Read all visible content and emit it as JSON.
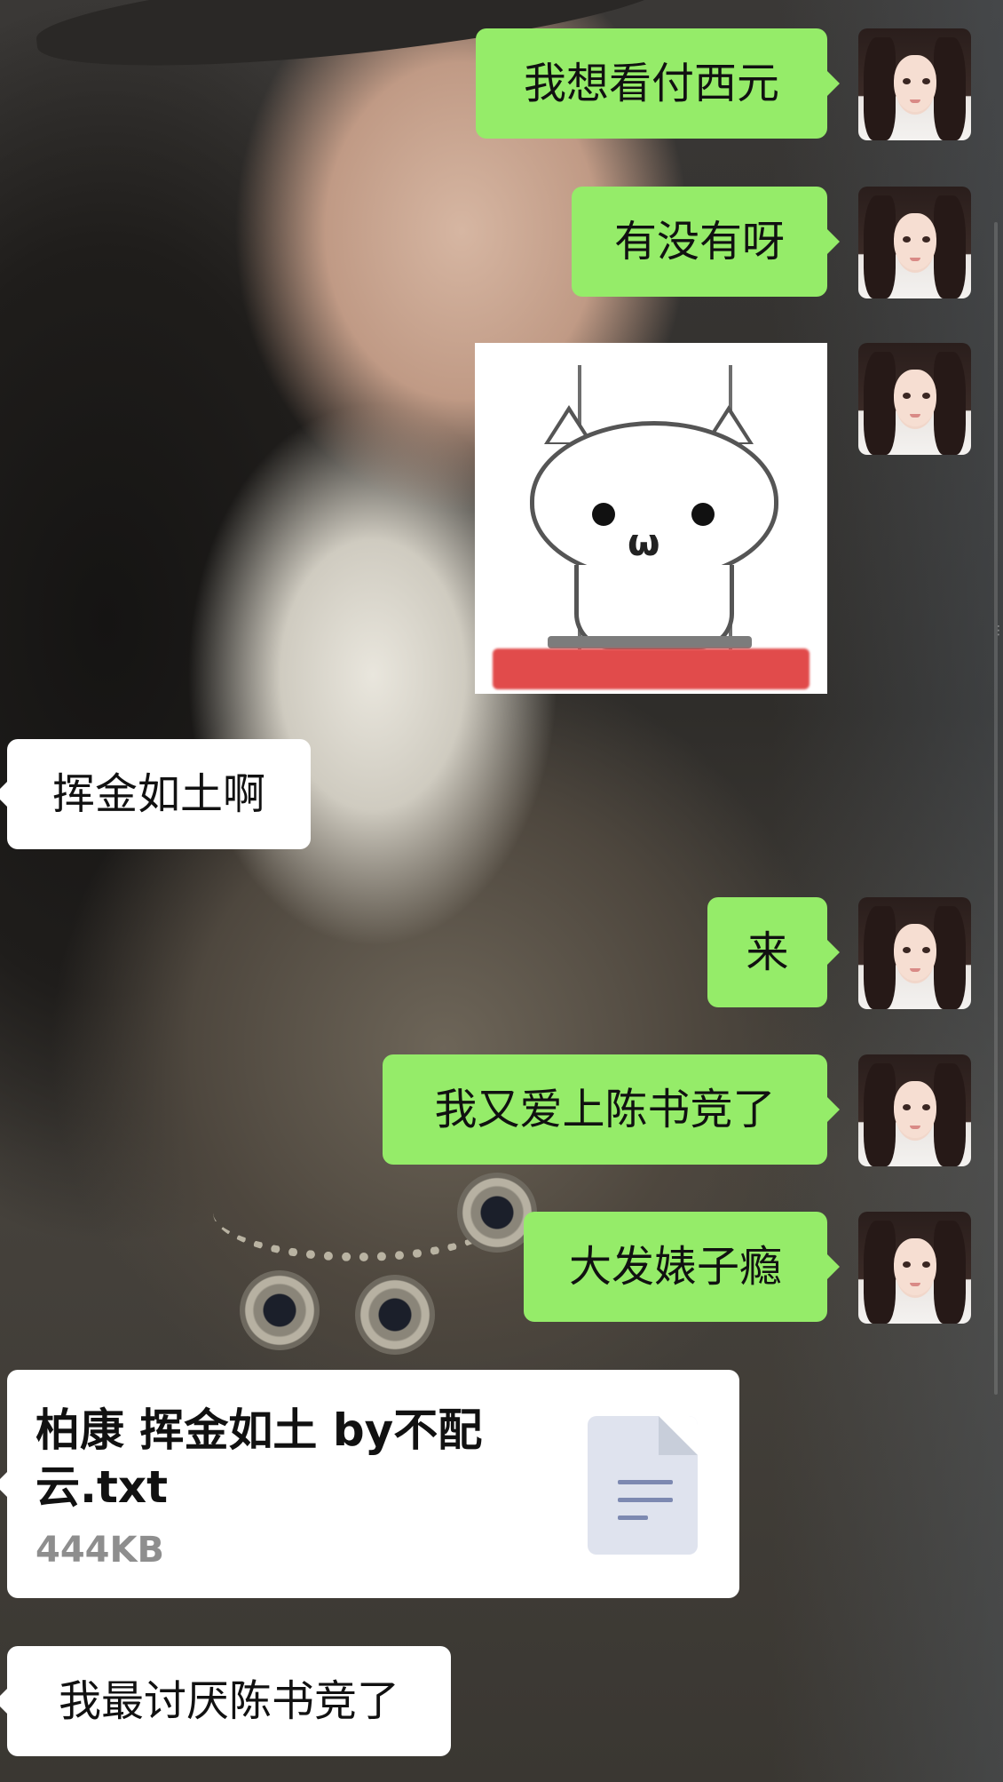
{
  "chat": {
    "messages": [
      {
        "id": "m1",
        "side": "out",
        "text": "我想看付西元"
      },
      {
        "id": "m2",
        "side": "out",
        "text": "有没有呀"
      },
      {
        "id": "m3",
        "side": "out",
        "type": "sticker",
        "sticker": "cat-on-swing"
      },
      {
        "id": "m4",
        "side": "in",
        "text": "挥金如土啊"
      },
      {
        "id": "m5",
        "side": "out",
        "text": "来"
      },
      {
        "id": "m6",
        "side": "out",
        "text": "我又爱上陈书竞了"
      },
      {
        "id": "m7",
        "side": "out",
        "text": "大发婊子瘾"
      },
      {
        "id": "m8",
        "side": "in",
        "type": "file",
        "file_name": "柏康 挥金如土 by不配云.txt",
        "file_size": "444KB",
        "icon": "document-icon"
      },
      {
        "id": "m9",
        "side": "in",
        "text": "我最讨厌陈书竞了"
      }
    ]
  },
  "colors": {
    "outgoing_bubble": "#95ec69",
    "incoming_bubble": "#ffffff",
    "file_icon_bg": "#dfe3ee",
    "file_icon_lines": "#7d89b1"
  }
}
